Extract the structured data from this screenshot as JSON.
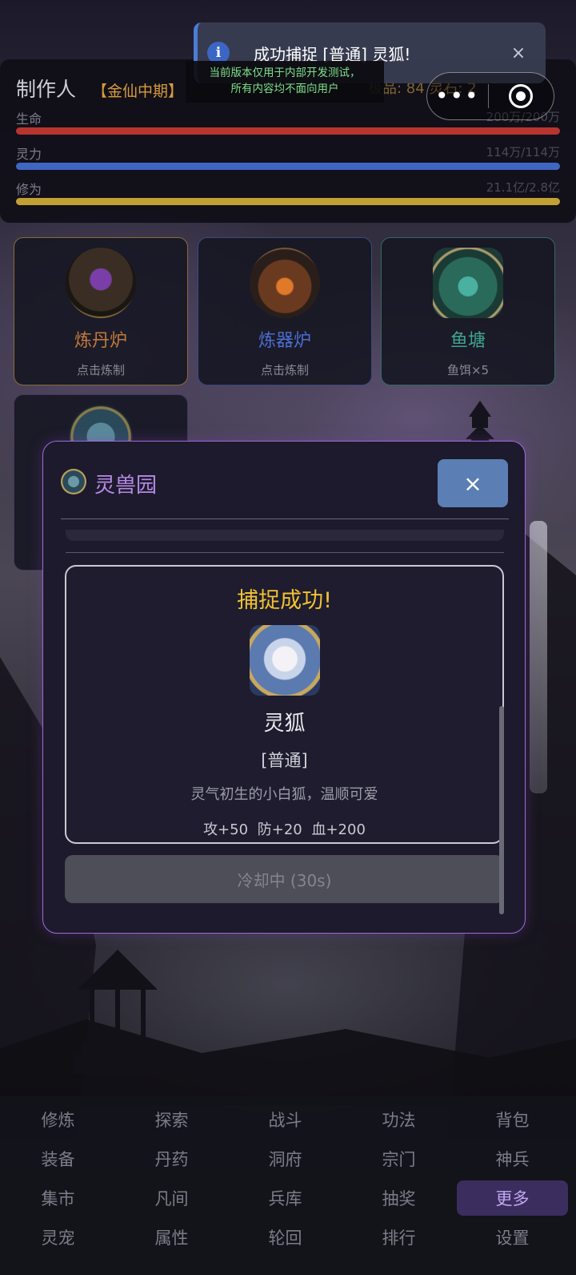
{
  "toast": {
    "message": "成功捕捉 [普通] 灵狐!",
    "icon": "info-icon",
    "close": "×"
  },
  "dev_note": {
    "line1": "当前版本仅用于内部开发测试，",
    "line2": "所有内容均不面向用户"
  },
  "status": {
    "name": "制作人",
    "realm": "【金仙中期】",
    "right_text": "极品: 84  灵石: 2",
    "hp_label": "生命",
    "hp_value": "200万/200万",
    "hp_fraction": 1.0,
    "mp_label": "灵力",
    "mp_value": "114万/114万",
    "mp_fraction": 1.0,
    "xp_label": "修为",
    "xp_value": "21.1亿/2.8亿",
    "xp_fraction": 1.0
  },
  "capsule": {
    "more": "•••",
    "close_icon": "target-icon"
  },
  "facilities": [
    {
      "title": "炼丹炉",
      "sub": "点击炼制",
      "icon": "alchemy-furnace-icon"
    },
    {
      "title": "炼器炉",
      "sub": "点击炼制",
      "icon": "forge-furnace-icon"
    },
    {
      "title": "鱼塘",
      "sub": "鱼饵×5",
      "icon": "fish-pond-icon"
    }
  ],
  "modal": {
    "title": "灵兽园",
    "close": "×",
    "result": {
      "title": "捕捉成功!",
      "pet_name": "灵狐",
      "rarity": "[普通]",
      "description": "灵气初生的小白狐，温顺可爱",
      "stats": "攻+50  防+20  血+200"
    },
    "cooldown_button": "冷却中 (30s)"
  },
  "nav": [
    [
      "修炼",
      "探索",
      "战斗",
      "功法",
      "背包"
    ],
    [
      "装备",
      "丹药",
      "洞府",
      "宗门",
      "神兵"
    ],
    [
      "集市",
      "凡间",
      "兵库",
      "抽奖",
      "更多"
    ],
    [
      "灵宠",
      "属性",
      "轮回",
      "排行",
      "设置"
    ]
  ],
  "nav_active": "更多",
  "colors": {
    "accent": "#9f6ad6",
    "gold": "#f1c232",
    "hp": "#b8342e",
    "mp": "#3f66c2",
    "xp": "#c2a033"
  }
}
